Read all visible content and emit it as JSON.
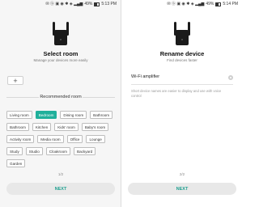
{
  "left_screen": {
    "status": {
      "icons": "✉ ⓑ ▣ ◉ ✱ ◈ ▂▄▆",
      "battery": "49%",
      "time": "5:13 PM"
    },
    "title": "Select room",
    "subtitle": "Manage your devices more easily",
    "add_button": "+",
    "section_title": "Recommended room",
    "rooms": [
      {
        "label": "Living room",
        "selected": false
      },
      {
        "label": "Bedroom",
        "selected": true
      },
      {
        "label": "Dining room",
        "selected": false
      },
      {
        "label": "Bathroom",
        "selected": false
      },
      {
        "label": "Bathroom",
        "selected": false
      },
      {
        "label": "Kitchen",
        "selected": false
      },
      {
        "label": "Kids' room",
        "selected": false
      },
      {
        "label": "Baby's room",
        "selected": false
      },
      {
        "label": "Activity room",
        "selected": false
      },
      {
        "label": "Media room",
        "selected": false
      },
      {
        "label": "Office",
        "selected": false
      },
      {
        "label": "Lounge",
        "selected": false
      },
      {
        "label": "Study",
        "selected": false
      },
      {
        "label": "Studio",
        "selected": false
      },
      {
        "label": "Cloakroom",
        "selected": false
      },
      {
        "label": "Backyard",
        "selected": false
      },
      {
        "label": "Garden",
        "selected": false
      }
    ],
    "pager": "1/2",
    "next_label": "NEXT"
  },
  "right_screen": {
    "status": {
      "icons": "✉ ⓑ ▣ ◉ ✱ ◈ ▂▄▆",
      "battery": "49%",
      "time": "5:14 PM"
    },
    "title": "Rename device",
    "subtitle": "Find devices faster",
    "device_name_value": "Wi-Fi amplifier",
    "hint": "Short device names are easier to display and use with voice control",
    "pager": "2/2",
    "next_label": "NEXT"
  },
  "colors": {
    "accent": "#20b09b",
    "next_text": "#20a090",
    "button_bg": "#e8e8e8"
  }
}
